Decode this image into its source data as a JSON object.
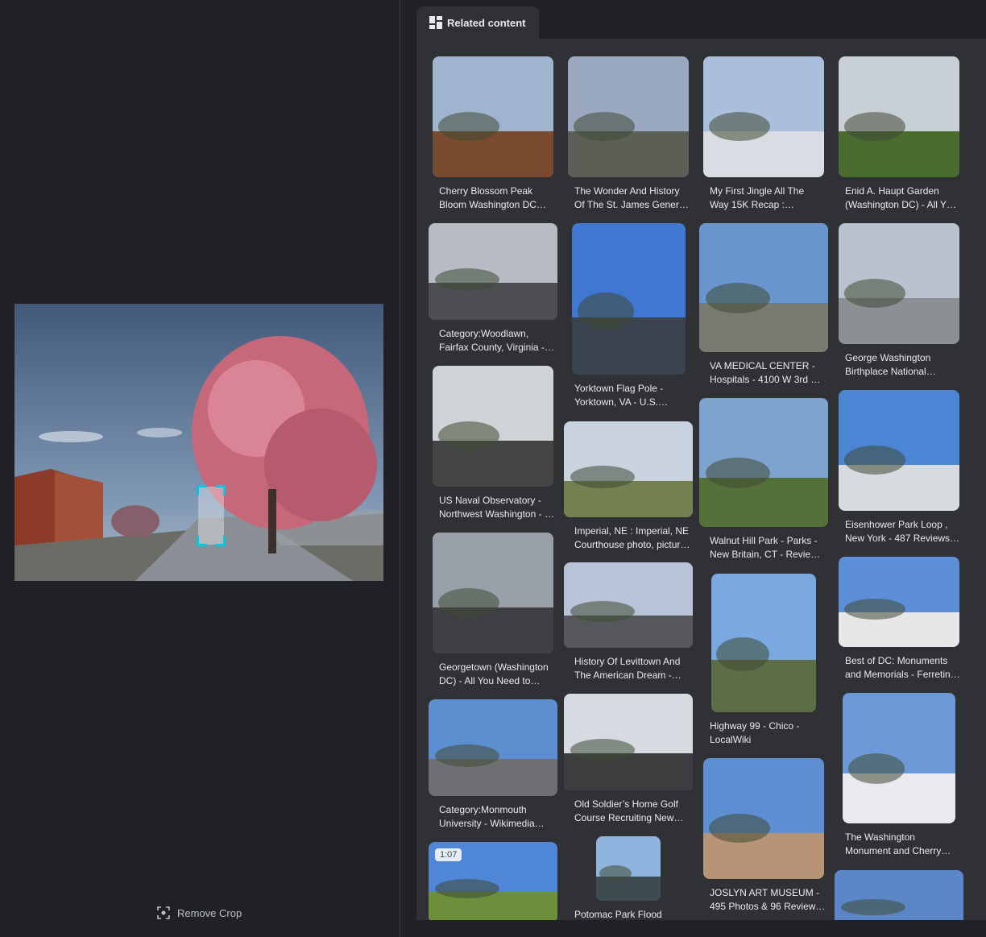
{
  "tab": {
    "label": "Related content",
    "icon": "grid-icon"
  },
  "remove_crop": {
    "label": "Remove Crop",
    "icon": "crop-icon"
  },
  "results": [
    {
      "caption": "Cherry Blossom Peak Bloom Washington DC…",
      "sky": "#9fb4cf",
      "ground": "#7a4a2e"
    },
    {
      "caption": "The Wonder And History Of The St. James Gener…",
      "sky": "#9aa8c0",
      "ground": "#5b5f55"
    },
    {
      "caption": "My First Jingle All The Way 15K Recap :…",
      "sky": "#a9bfdc",
      "ground": "#d9dde3"
    },
    {
      "caption": "Enid A. Haupt Garden (Washington DC) - All Y…",
      "sky": "#c9cfd6",
      "ground": "#4a6b2e"
    },
    {
      "caption": "Category:Woodlawn, Fairfax County, Virginia -…",
      "sky": "#b7bcc4",
      "ground": "#4d4f52"
    },
    {
      "caption": "US Naval Observatory - Northwest Washington - …",
      "sky": "#cfd3d6",
      "ground": "#444"
    },
    {
      "caption": "Georgetown (Washington DC) - All You Need to…",
      "sky": "#9aa0aa",
      "ground": "#3f3f44"
    },
    {
      "caption": "Category:Monmouth University - Wikimedia…",
      "sky": "#5d8fd0",
      "ground": "#6e6f72"
    },
    {
      "caption": "",
      "duration": "1:07",
      "sky": "#4f86d6",
      "ground": "#6d8f3c"
    },
    {
      "caption": "Yorktown Flag Pole - Yorktown, VA - U.S.…",
      "sky": "#3f77d2",
      "ground": "#39444f"
    },
    {
      "caption": "Imperial, NE : Imperial, NE Courthouse photo, pictur…",
      "sky": "#c8d3df",
      "ground": "#74804f"
    },
    {
      "caption": "History Of Levittown And The American Dream -…",
      "sky": "#b9c3d7",
      "ground": "#55575a"
    },
    {
      "caption": "Old Soldier’s Home Golf Course Recruiting New…",
      "sky": "#d6dbe2",
      "ground": "#3b3d3f"
    },
    {
      "caption": "Potomac Park Flood",
      "sky": "#8fb4de",
      "ground": "#3f4b53"
    },
    {
      "caption": "VA MEDICAL CENTER - Hospitals - 4100 W 3rd …",
      "sky": "#6a96cf",
      "ground": "#7a7a72"
    },
    {
      "caption": "Walnut Hill Park - Parks - New Britain, CT - Revie…",
      "sky": "#7fa3cf",
      "ground": "#54713a"
    },
    {
      "caption": "Highway 99 - Chico - LocalWiki",
      "sky": "#79a9e0",
      "ground": "#5d6d45"
    },
    {
      "caption": "JOSLYN ART MUSEUM - 495 Photos & 96 Review…",
      "sky": "#5e8fd3",
      "ground": "#b89477"
    },
    {
      "caption": "George Washington Birthplace National…",
      "sky": "#b8c3cf",
      "ground": "#8c8f94"
    },
    {
      "caption": "Eisenhower Park Loop , New York - 487 Reviews…",
      "sky": "#4b86d4",
      "ground": "#d8dbe0"
    },
    {
      "caption": "Best of DC: Monuments and Memorials - Ferretin…",
      "sky": "#5c8fd8",
      "ground": "#e9e6ea"
    },
    {
      "caption": "The Washington Monument and Cherry…",
      "sky": "#6c9ad6",
      "ground": "#ece9ee"
    },
    {
      "caption": "",
      "sky": "#5b86c8",
      "ground": "#5b86c8"
    }
  ]
}
